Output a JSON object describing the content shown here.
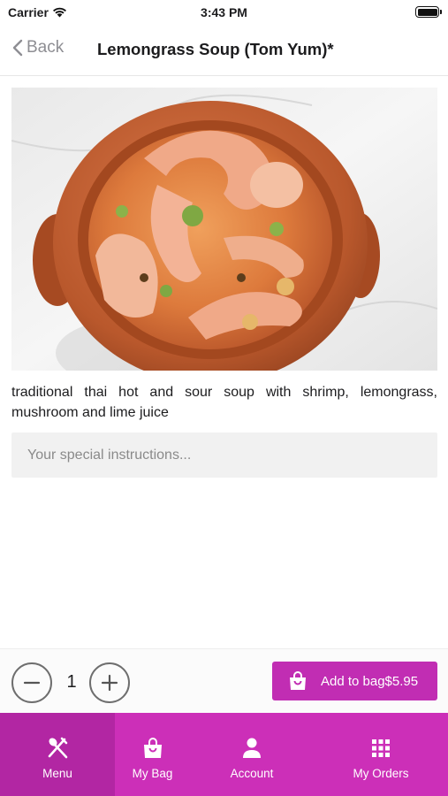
{
  "status_bar": {
    "carrier": "Carrier",
    "time": "3:43 PM"
  },
  "nav": {
    "back_label": "Back",
    "title": "Lemongrass Soup (Tom Yum)*"
  },
  "dish": {
    "description": "traditional thai hot and sour soup with shrimp, lemongrass, mushroom and lime juice",
    "instructions_placeholder": "Your special instructions...",
    "instructions_value": ""
  },
  "order": {
    "quantity": "1",
    "add_label": "Add to bag$5.95"
  },
  "tabs": [
    {
      "label": "Menu",
      "icon": "fork-spoon-icon",
      "active": true
    },
    {
      "label": "My Bag",
      "icon": "shopping-bag-icon",
      "active": false
    },
    {
      "label": "Account",
      "icon": "person-icon",
      "active": false
    },
    {
      "label": "My Orders",
      "icon": "grid-icon",
      "active": false
    }
  ],
  "colors": {
    "accent": "#cc2fb8",
    "accent_dark": "#b226a3",
    "button": "#c12db3"
  }
}
